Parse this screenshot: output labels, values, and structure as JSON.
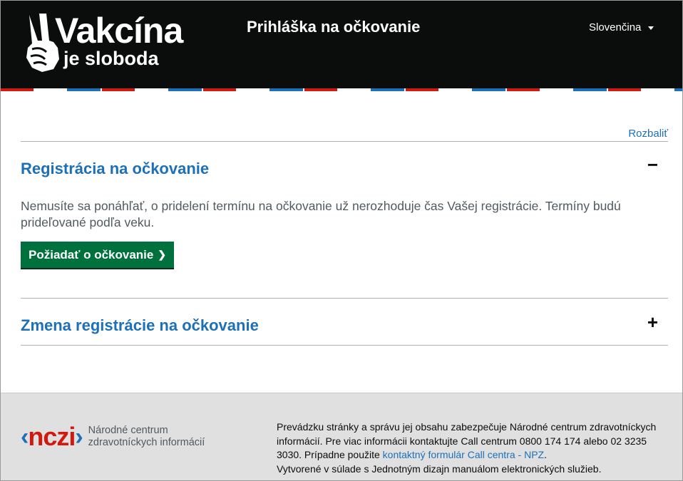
{
  "header": {
    "logo_main": "Vakcína",
    "logo_sub": "je sloboda",
    "title": "Prihláška na očkovanie",
    "language": "Slovenčina"
  },
  "main": {
    "expand_all": "Rozbaliť",
    "sections": [
      {
        "title": "Registrácia na očkovanie",
        "state_icon": "−",
        "notice": "Nemusíte sa ponáhľať, o pridelení termínu na očkovanie už nerozhoduje čas Vašej registrácie. Termíny budú prideľované podľa veku.",
        "button": "Požiadať o očkovanie"
      },
      {
        "title": "Zmena registrácie na očkovanie",
        "state_icon": "+"
      }
    ]
  },
  "footer": {
    "nczi_mark": "nczi",
    "nczi_line1": "Národné centrum",
    "nczi_line2": "zdravotníckych informácií",
    "text_before_link": "Prevádzku stránky a správu jej obsahu zabezpečuje Národné centrum zdravotníckych informácií. Pre viac informácii kontaktujte Call centrum 0800 174 174 alebo 02 3235 3030. Prípadne použite ",
    "link": "kontaktný formulár Call centra - NPZ",
    "text_after_link": ".",
    "line_last": "Vytvorené v súlade s Jednotným dizajn manuálom elektronických služieb."
  },
  "colors": {
    "header_bg": "#0b0c0c",
    "link_blue": "#1d70b8",
    "button_green": "#00703c",
    "stripe_red": "#d0190f",
    "footer_bg": "#e0e0e0"
  },
  "icons": [
    "peace-hand-icon",
    "chevron-down-icon",
    "minus-icon",
    "plus-icon",
    "chevron-right-icon",
    "nczi-logo-icon"
  ]
}
